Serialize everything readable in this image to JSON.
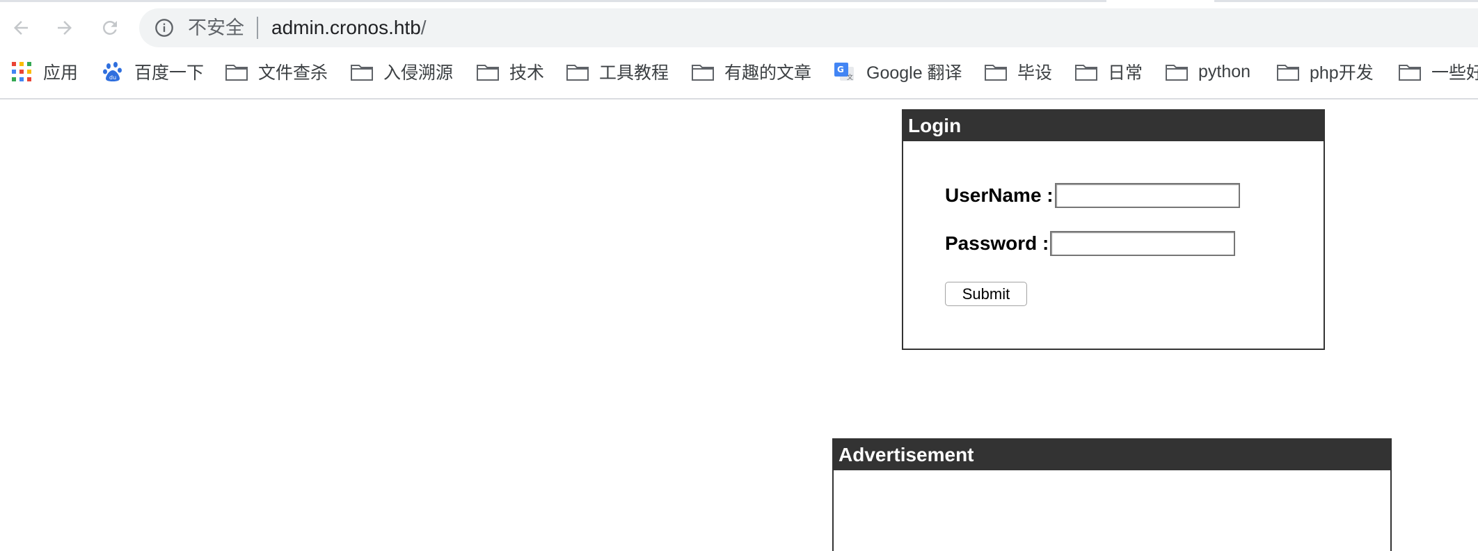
{
  "browser": {
    "back_icon": "arrow-left-icon",
    "forward_icon": "arrow-right-icon",
    "reload_icon": "reload-icon",
    "security_icon": "info-icon",
    "security_label": "不安全",
    "url_host": "admin.cronos.htb",
    "url_path": "/"
  },
  "bookmarks": [
    {
      "label": "应用",
      "icon": "apps-grid-icon"
    },
    {
      "label": "百度一下",
      "icon": "baidu-paw-icon"
    },
    {
      "label": "文件查杀",
      "icon": "folder-icon"
    },
    {
      "label": "入侵溯源",
      "icon": "folder-icon"
    },
    {
      "label": "技术",
      "icon": "folder-icon"
    },
    {
      "label": "工具教程",
      "icon": "folder-icon"
    },
    {
      "label": "有趣的文章",
      "icon": "folder-icon"
    },
    {
      "label": "Google 翻译",
      "icon": "google-translate-icon"
    },
    {
      "label": "毕设",
      "icon": "folder-icon"
    },
    {
      "label": "日常",
      "icon": "folder-icon"
    },
    {
      "label": "python",
      "icon": "folder-icon"
    },
    {
      "label": "php开发",
      "icon": "folder-icon"
    },
    {
      "label": "一些好",
      "icon": "folder-icon"
    }
  ],
  "login": {
    "title": "Login",
    "username_label": "UserName :",
    "username_value": "",
    "password_label": "Password :",
    "password_value": "",
    "submit_label": "Submit"
  },
  "advertisement": {
    "title": "Advertisement"
  },
  "colors": {
    "panel_header_bg": "#333333",
    "panel_header_text": "#ffffff",
    "toolbar_bg": "#ffffff",
    "omnibox_bg": "#f1f3f4"
  }
}
